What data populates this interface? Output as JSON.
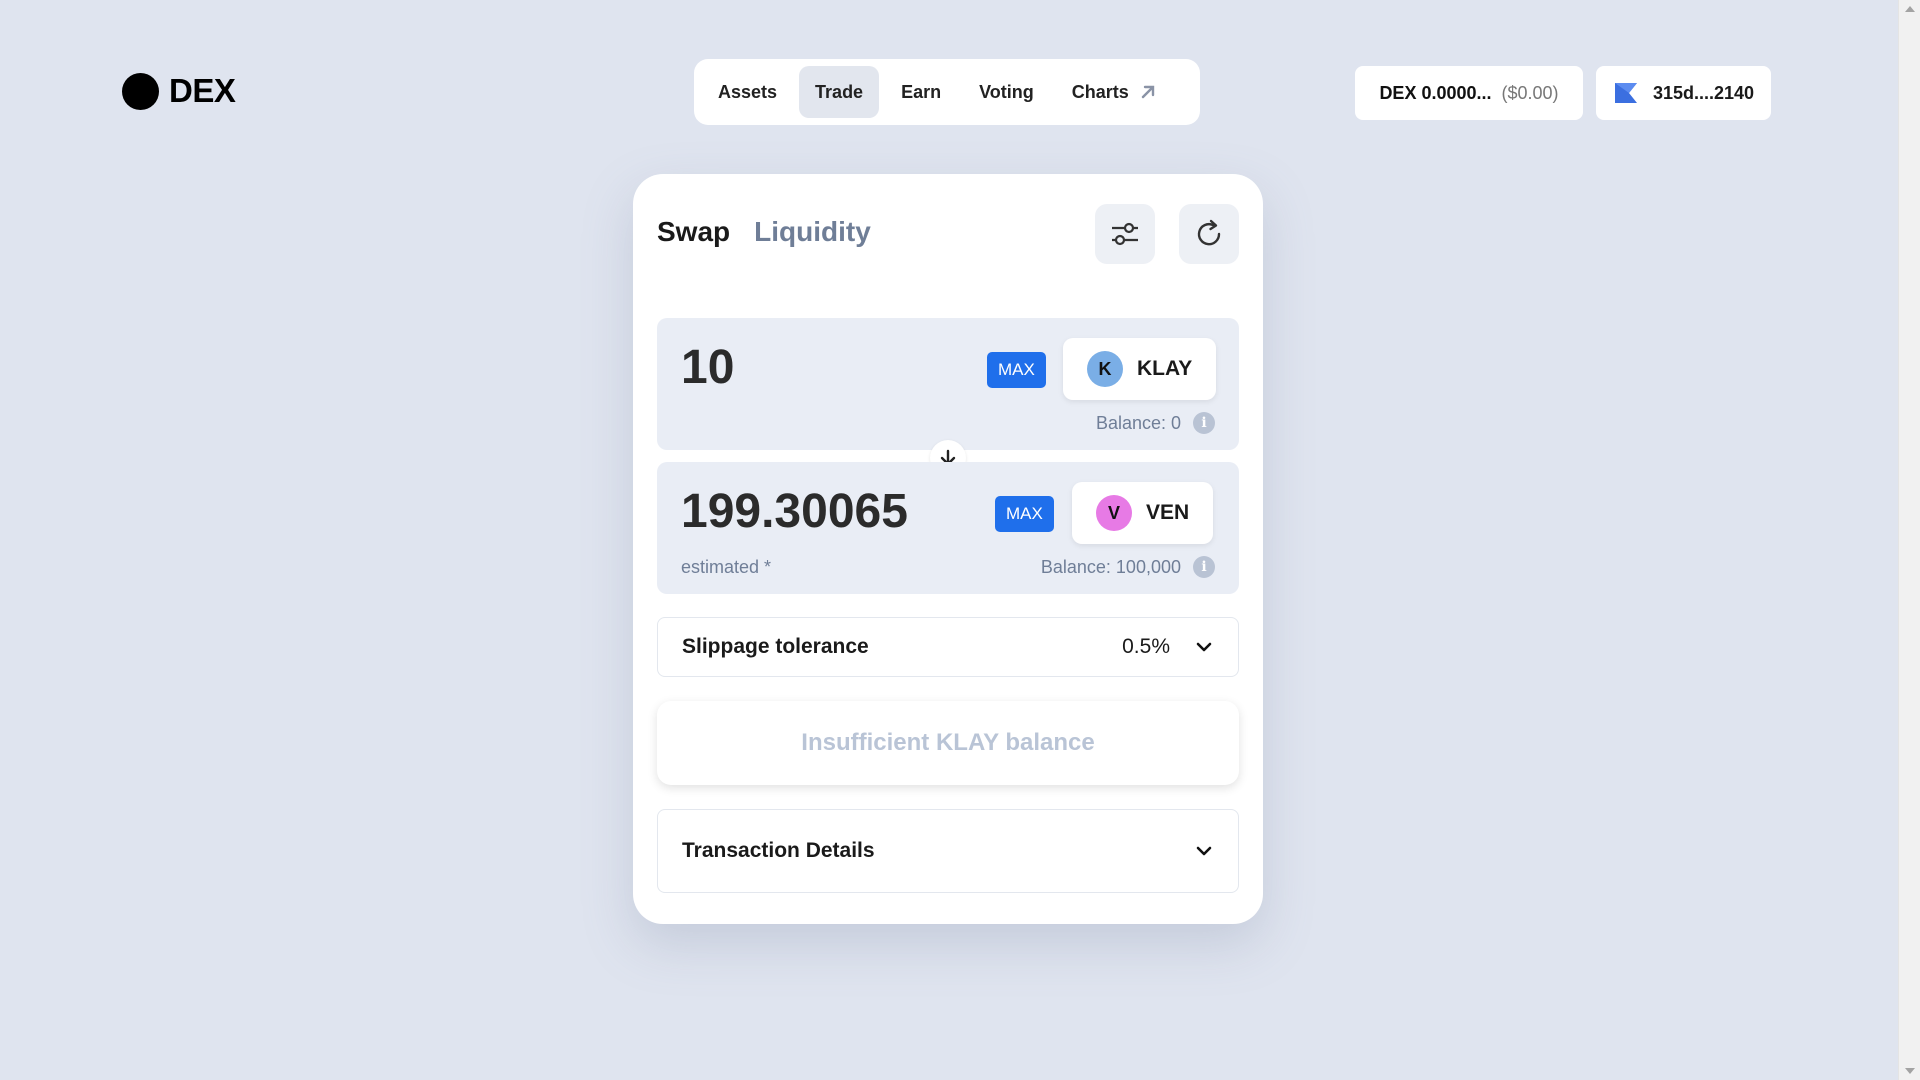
{
  "brand": {
    "name": "DEX"
  },
  "nav": {
    "items": [
      {
        "label": "Assets",
        "active": false
      },
      {
        "label": "Trade",
        "active": true
      },
      {
        "label": "Earn",
        "active": false
      },
      {
        "label": "Voting",
        "active": false
      },
      {
        "label": "Charts",
        "active": false,
        "icon": "external-arrow-icon"
      }
    ]
  },
  "header": {
    "balance_token": "DEX 0.0000...",
    "balance_usd": "($0.00)",
    "wallet_address": "315d....2140",
    "wallet_icon": "wallet-icon"
  },
  "swap": {
    "tabs": [
      {
        "label": "Swap",
        "active": true
      },
      {
        "label": "Liquidity",
        "active": false
      }
    ],
    "settings_icon": "sliders-icon",
    "refresh_icon": "refresh-icon",
    "from": {
      "amount": "10",
      "max_label": "MAX",
      "token_symbol": "KLAY",
      "token_letter": "K",
      "token_color": "#7aaee6",
      "balance": "Balance: 0"
    },
    "to": {
      "amount": "199.30065",
      "max_label": "MAX",
      "token_symbol": "VEN",
      "token_letter": "V",
      "token_color": "#e77ae5",
      "balance": "Balance: 100,000",
      "estimated_label": "estimated *"
    },
    "slippage": {
      "label": "Slippage tolerance",
      "value": "0.5%"
    },
    "cta_label": "Insufficient KLAY balance",
    "details_label": "Transaction Details"
  },
  "colors": {
    "background": "#dfe4ef",
    "accent": "#1f6feb",
    "muted": "#6f7e97"
  }
}
